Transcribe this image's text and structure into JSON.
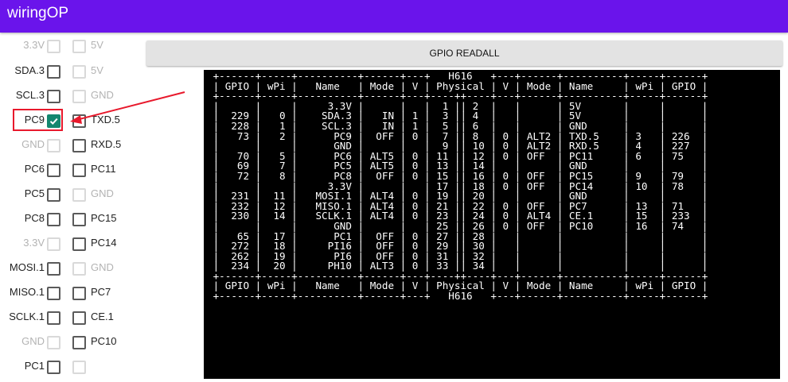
{
  "app": {
    "title": "wiringOP"
  },
  "button": {
    "label": "GPIO READALL"
  },
  "pins": [
    {
      "left": "3.3V",
      "left_enabled": false,
      "left_checked": false,
      "right": "5V",
      "right_enabled": false,
      "right_checked": false
    },
    {
      "left": "SDA.3",
      "left_enabled": true,
      "left_checked": false,
      "right": "5V",
      "right_enabled": false,
      "right_checked": false
    },
    {
      "left": "SCL.3",
      "left_enabled": true,
      "left_checked": false,
      "right": "GND",
      "right_enabled": false,
      "right_checked": false
    },
    {
      "left": "PC9",
      "left_enabled": true,
      "left_checked": true,
      "right": "TXD.5",
      "right_enabled": true,
      "right_checked": false
    },
    {
      "left": "GND",
      "left_enabled": false,
      "left_checked": false,
      "right": "RXD.5",
      "right_enabled": true,
      "right_checked": false
    },
    {
      "left": "PC6",
      "left_enabled": true,
      "left_checked": false,
      "right": "PC11",
      "right_enabled": true,
      "right_checked": false
    },
    {
      "left": "PC5",
      "left_enabled": true,
      "left_checked": false,
      "right": "GND",
      "right_enabled": false,
      "right_checked": false
    },
    {
      "left": "PC8",
      "left_enabled": true,
      "left_checked": false,
      "right": "PC15",
      "right_enabled": true,
      "right_checked": false
    },
    {
      "left": "3.3V",
      "left_enabled": false,
      "left_checked": false,
      "right": "PC14",
      "right_enabled": true,
      "right_checked": false
    },
    {
      "left": "MOSI.1",
      "left_enabled": true,
      "left_checked": false,
      "right": "GND",
      "right_enabled": false,
      "right_checked": false
    },
    {
      "left": "MISO.1",
      "left_enabled": true,
      "left_checked": false,
      "right": "PC7",
      "right_enabled": true,
      "right_checked": false
    },
    {
      "left": "SCLK.1",
      "left_enabled": true,
      "left_checked": false,
      "right": "CE.1",
      "right_enabled": true,
      "right_checked": false
    },
    {
      "left": "GND",
      "left_enabled": false,
      "left_checked": false,
      "right": "PC10",
      "right_enabled": true,
      "right_checked": false
    },
    {
      "left": "PC1",
      "left_enabled": true,
      "left_checked": false,
      "right": "",
      "right_enabled": false,
      "right_checked": false
    }
  ],
  "terminal": {
    "lines": [
      " +------+-----+----------+------+---+   H616   +---+------+----------+-----+------+",
      " | GPIO | wPi |   Name   | Mode | V | Physical | V | Mode | Name     | wPi | GPIO |",
      " +------+-----+----------+------+---+----++----+---+------+----------+-----+------+",
      " |      |     |     3.3V |      |   |  1 || 2  |   |      | 5V       |     |      |",
      " |  229 |   0 |    SDA.3 |   IN | 1 |  3 || 4  |   |      | 5V       |     |      |",
      " |  228 |   1 |    SCL.3 |   IN | 1 |  5 || 6  |   |      | GND      |     |      |",
      " |   73 |   2 |      PC9 |  OFF | 0 |  7 || 8  | 0 | ALT2 | TXD.5    | 3   | 226  |",
      " |      |     |      GND |      |   |  9 || 10 | 0 | ALT2 | RXD.5    | 4   | 227  |",
      " |   70 |   5 |      PC6 | ALT5 | 0 | 11 || 12 | 0 | OFF  | PC11     | 6   | 75   |",
      " |   69 |   7 |      PC5 | ALT5 | 0 | 13 || 14 |   |      | GND      |     |      |",
      " |   72 |   8 |      PC8 |  OFF | 0 | 15 || 16 | 0 | OFF  | PC15     | 9   | 79   |",
      " |      |     |     3.3V |      |   | 17 || 18 | 0 | OFF  | PC14     | 10  | 78   |",
      " |  231 |  11 |   MOSI.1 | ALT4 | 0 | 19 || 20 |   |      | GND      |     |      |",
      " |  232 |  12 |   MISO.1 | ALT4 | 0 | 21 || 22 | 0 | OFF  | PC7      | 13  | 71   |",
      " |  230 |  14 |   SCLK.1 | ALT4 | 0 | 23 || 24 | 0 | ALT4 | CE.1     | 15  | 233  |",
      " |      |     |      GND |      |   | 25 || 26 | 0 | OFF  | PC10     | 16  | 74   |",
      " |   65 |  17 |      PC1 |  OFF | 0 | 27 || 28 |   |      |          |     |      |",
      " |  272 |  18 |     PI16 |  OFF | 0 | 29 || 30 |   |      |          |     |      |",
      " |  262 |  19 |      PI6 |  OFF | 0 | 31 || 32 |   |      |          |     |      |",
      " |  234 |  20 |     PH10 | ALT3 | 0 | 33 || 34 |   |      |          |     |      |",
      " +------+-----+----------+------+---+----++----+---+------+----------+-----+------+",
      " | GPIO | wPi |   Name   | Mode | V | Physical | V | Mode | Name     | wPi | GPIO |",
      " +------+-----+----------+------+---+   H616   +---+------+----------+-----+------+"
    ]
  },
  "colors": {
    "appbar": "#6a14eb",
    "checked": "#13876f",
    "highlight": "#e8192c"
  }
}
